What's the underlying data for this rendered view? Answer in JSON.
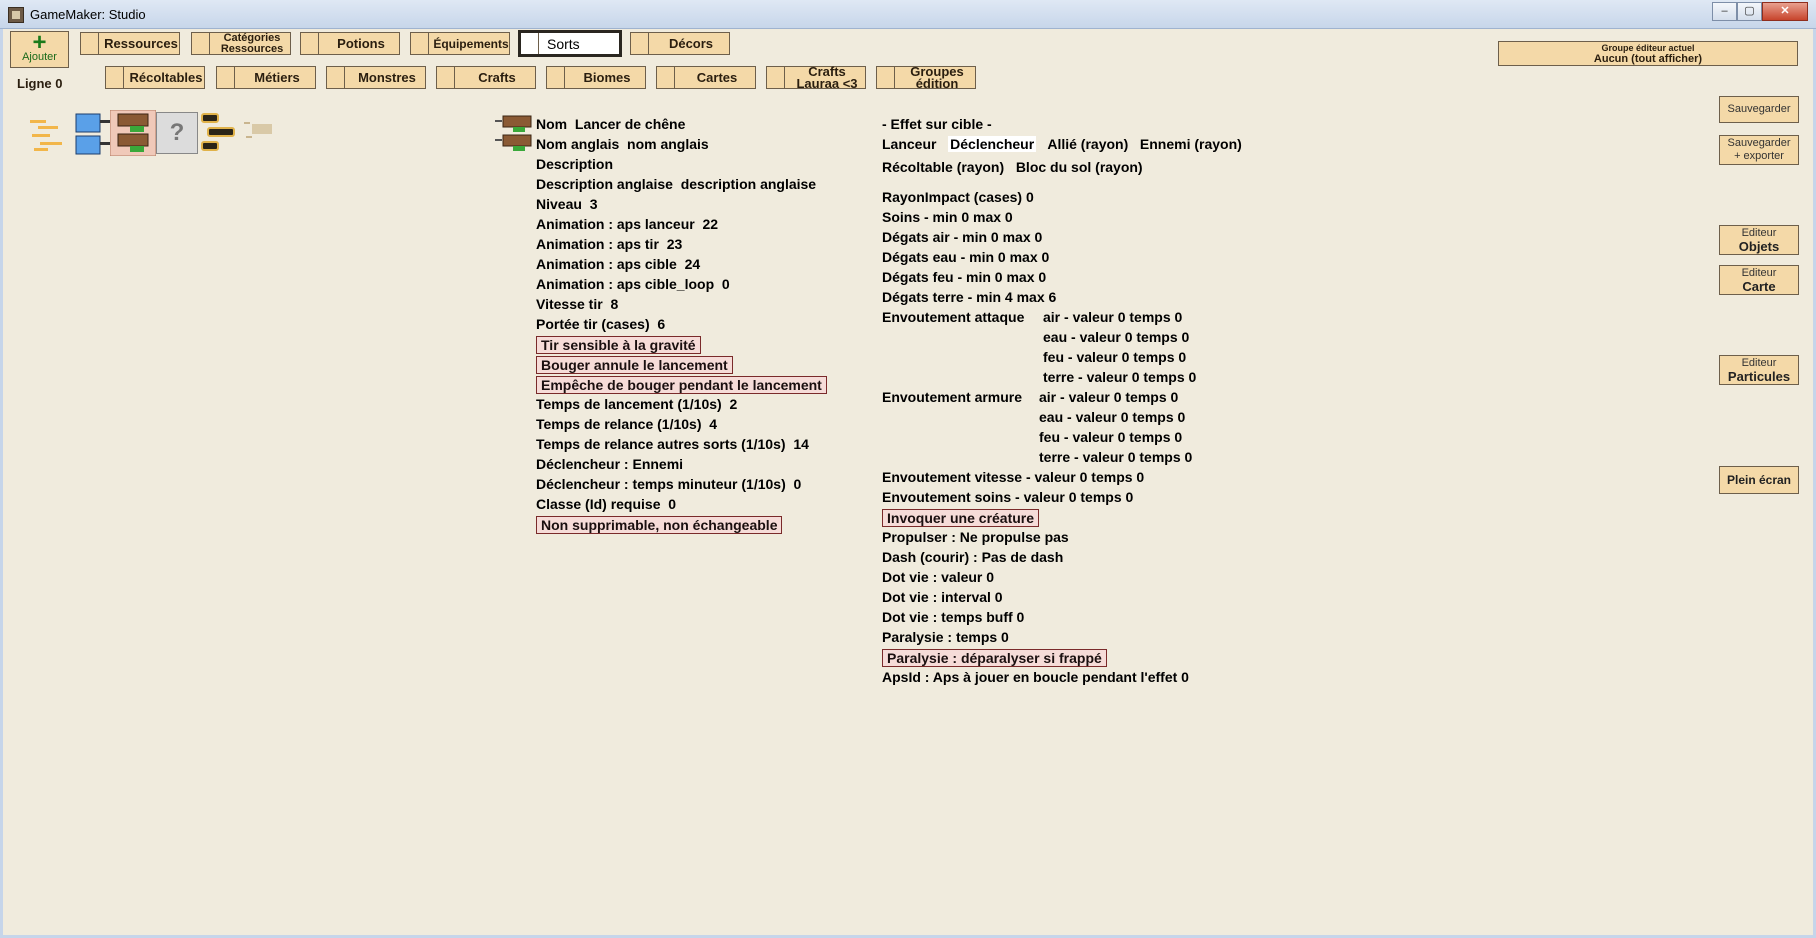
{
  "window": {
    "title": "GameMaker: Studio",
    "min": "–",
    "max": "▢",
    "close": "✕"
  },
  "toolbar": {
    "add_plus": "+",
    "add_label": "Ajouter",
    "row_label": "Ligne 0",
    "tabs_row1": [
      {
        "label": "Ressources"
      },
      {
        "label1": "Catégories",
        "label2": "Ressources"
      },
      {
        "label": "Potions"
      },
      {
        "label": "Équipements"
      },
      {
        "label": "Sorts"
      },
      {
        "label": "Décors"
      }
    ],
    "tabs_row2": [
      {
        "label": "Récoltables"
      },
      {
        "label": "Métiers"
      },
      {
        "label": "Monstres"
      },
      {
        "label": "Crafts"
      },
      {
        "label": "Biomes"
      },
      {
        "label": "Cartes"
      },
      {
        "label1": "Crafts",
        "label2": "Lauraa <3"
      },
      {
        "label1": "Groupes",
        "label2": "édition"
      }
    ],
    "group": {
      "title": "Groupe éditeur actuel",
      "value": "Aucun (tout afficher)"
    }
  },
  "side_buttons": {
    "save": "Sauvegarder",
    "save_export_1": "Sauvegarder",
    "save_export_2": "+ exporter",
    "objects_1": "Editeur",
    "objects_2": "Objets",
    "map_1": "Editeur",
    "map_2": "Carte",
    "particles_1": "Editeur",
    "particles_2": "Particules",
    "fullscreen": "Plein écran"
  },
  "thumbnail_unknown": "?",
  "spell": {
    "name_k": "Nom",
    "name_v": "Lancer de chêne",
    "name_en_k": "Nom anglais",
    "name_en_v": "nom anglais",
    "desc_k": "Description",
    "desc_en_k": "Description anglaise",
    "desc_en_v": "description anglaise",
    "level_k": "Niveau",
    "level_v": "3",
    "anim_caster_k": "Animation : aps lanceur",
    "anim_caster_v": "22",
    "anim_shot_k": "Animation : aps tir",
    "anim_shot_v": "23",
    "anim_target_k": "Animation : aps cible",
    "anim_target_v": "24",
    "anim_target_loop_k": "Animation : aps cible_loop",
    "anim_target_loop_v": "0",
    "shot_speed_k": "Vitesse tir",
    "shot_speed_v": "8",
    "range_k": "Portée tir (cases)",
    "range_v": "6",
    "flag_gravity": "Tir sensible à la gravité",
    "flag_move_cancel": "Bouger annule le lancement",
    "flag_no_move": "Empêche de bouger pendant le lancement",
    "cast_time_k": "Temps de lancement (1/10s)",
    "cast_time_v": "2",
    "cooldown_k": "Temps de relance (1/10s)",
    "cooldown_v": "4",
    "cooldown_others_k": "Temps de relance autres sorts (1/10s)",
    "cooldown_others_v": "14",
    "trigger_k": "Déclencheur : Ennemi",
    "trigger_timer_k": "Déclencheur : temps minuteur (1/10s)",
    "trigger_timer_v": "0",
    "class_k": "Classe (Id) requise",
    "class_v": "0",
    "flag_undeletable": "Non supprimable, non échangeable"
  },
  "effect": {
    "header": "- Effet sur cible -",
    "targets_row1": [
      "Lanceur",
      "Déclencheur",
      "Allié (rayon)",
      "Ennemi (rayon)"
    ],
    "targets_row2": [
      "Récoltable (rayon)",
      "Bloc du sol (rayon)"
    ],
    "radius": "RayonImpact (cases)  0",
    "heal": "Soins  -  min  0   max  0",
    "dmg_air": "Dégats air  -  min  0   max  0",
    "dmg_water": "Dégats eau  -  min  0   max  0",
    "dmg_fire": "Dégats feu  -  min  0   max  0",
    "dmg_earth": "Dégats terre  -  min  4   max  6",
    "curse_attack_k": "Envoutement attaque",
    "curse_attack_air": "air  -  valeur  0   temps  0",
    "curse_attack_water": "eau  -  valeur  0   temps  0",
    "curse_attack_fire": "feu  -  valeur  0   temps  0",
    "curse_attack_earth": "terre  -  valeur  0   temps  0",
    "curse_armor_k": "Envoutement armure",
    "curse_armor_air": "air  -  valeur  0   temps  0",
    "curse_armor_water": "eau  -  valeur  0   temps  0",
    "curse_armor_fire": "feu  -  valeur  0   temps  0",
    "curse_armor_earth": "terre  -  valeur  0   temps  0",
    "curse_speed": "Envoutement vitesse  -  valeur  0   temps  0",
    "curse_heal": "Envoutement soins  -  valeur  0   temps  0",
    "flag_summon": "Invoquer une créature",
    "push": "Propulser : Ne propulse pas",
    "dash": "Dash (courir) : Pas de dash",
    "dot_value": "Dot vie : valeur  0",
    "dot_interval": "Dot vie : interval  0",
    "dot_buff": "Dot vie : temps buff  0",
    "paralysis_time": "Paralysie : temps  0",
    "flag_paralysis": "Paralysie : déparalyser si frappé",
    "aps_loop": "ApsId : Aps à jouer en boucle pendant l'effet  0"
  },
  "colors": {
    "background": "#f0ebdd",
    "button": "#f4d9a8",
    "flag": "#f6dcd8",
    "flag_border": "#7a2a2a"
  }
}
